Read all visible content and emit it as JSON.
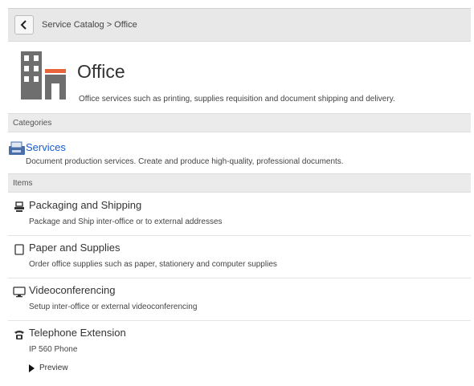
{
  "toolbar": {
    "breadcrumb": "Service Catalog > Office"
  },
  "header": {
    "title": "Office",
    "description": "Office services such as printing, supplies requisition and document shipping and delivery."
  },
  "sections": {
    "categories": "Categories",
    "items": "Items"
  },
  "categories": [
    {
      "name": "Services",
      "description": "Document production services. Create and produce high-quality, professional documents."
    }
  ],
  "items": [
    {
      "name": "Packaging and Shipping",
      "description": "Package and Ship inter-office or to external addresses",
      "icon": "package-icon"
    },
    {
      "name": "Paper and Supplies",
      "description": "Order office supplies such as paper, stationery and computer supplies",
      "icon": "document-icon"
    },
    {
      "name": "Videoconferencing",
      "description": "Setup inter-office or external videoconferencing",
      "icon": "monitor-icon"
    },
    {
      "name": "Telephone Extension",
      "description": "IP 560 Phone",
      "icon": "telephone-icon",
      "preview_label": "Preview"
    }
  ],
  "colors": {
    "link": "#1a5dcf",
    "accent": "#e8643a",
    "section_bg": "#ebebeb",
    "icon_gray": "#6e6e6e"
  }
}
